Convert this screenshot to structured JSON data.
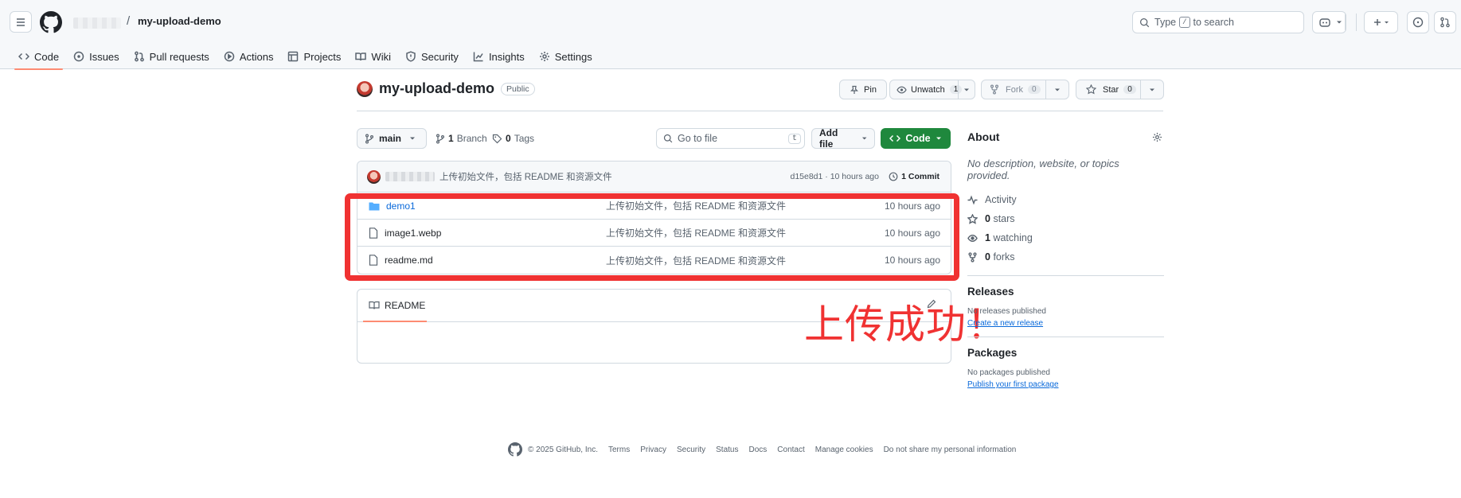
{
  "header": {
    "repo_crumb": "my-upload-demo",
    "search_placeholder_pre": "Type",
    "search_key": "/",
    "search_placeholder_post": "to search"
  },
  "tabs": [
    {
      "label": "Code",
      "icon": "code-icon"
    },
    {
      "label": "Issues",
      "icon": "issue-icon"
    },
    {
      "label": "Pull requests",
      "icon": "pull-request-icon"
    },
    {
      "label": "Actions",
      "icon": "play-icon"
    },
    {
      "label": "Projects",
      "icon": "table-icon"
    },
    {
      "label": "Wiki",
      "icon": "book-icon"
    },
    {
      "label": "Security",
      "icon": "shield-icon"
    },
    {
      "label": "Insights",
      "icon": "graph-icon"
    },
    {
      "label": "Settings",
      "icon": "gear-icon"
    }
  ],
  "repo": {
    "name": "my-upload-demo",
    "visibility": "Public",
    "pin": "Pin",
    "unwatch": "Unwatch",
    "watch_count": "1",
    "fork": "Fork",
    "fork_count": "0",
    "star": "Star",
    "star_count": "0"
  },
  "toolbar": {
    "branch": "main",
    "branch_count": "1",
    "branch_label": "Branch",
    "tag_count": "0",
    "tag_label": "Tags",
    "go_to_file": "Go to file",
    "go_to_file_key": "t",
    "add_file": "Add file",
    "code": "Code"
  },
  "commit": {
    "message": "上传初始文件，包括 README 和资源文件",
    "meta": "d15e8d1 · 10 hours ago",
    "count": "1 Commit"
  },
  "files": [
    {
      "name": "demo1",
      "type": "dir",
      "message": "上传初始文件，包括 README 和资源文件",
      "time": "10 hours ago"
    },
    {
      "name": "image1.webp",
      "type": "file",
      "message": "上传初始文件，包括 README 和资源文件",
      "time": "10 hours ago"
    },
    {
      "name": "readme.md",
      "type": "file",
      "message": "上传初始文件，包括 README 和资源文件",
      "time": "10 hours ago"
    }
  ],
  "readme": {
    "title": "README"
  },
  "annotation": {
    "text": "上传成功！",
    "color": "#f03232"
  },
  "about": {
    "title": "About",
    "description": "No description, website, or topics provided.",
    "activity": "Activity",
    "stars_count": "0",
    "stars_label": "stars",
    "watching_count": "1",
    "watching_label": "watching",
    "forks_count": "0",
    "forks_label": "forks",
    "releases_title": "Releases",
    "releases_none": "No releases published",
    "releases_link": "Create a new release",
    "packages_title": "Packages",
    "packages_none": "No packages published",
    "packages_link": "Publish your first package"
  },
  "footer": {
    "copyright": "© 2025 GitHub, Inc.",
    "links": [
      "Terms",
      "Privacy",
      "Security",
      "Status",
      "Docs",
      "Contact",
      "Manage cookies",
      "Do not share my personal information"
    ]
  },
  "colors": {
    "accent_green": "#1f883d",
    "link_blue": "#0969da",
    "tab_underline": "#fd8c73",
    "annotation_red": "#f03232"
  }
}
